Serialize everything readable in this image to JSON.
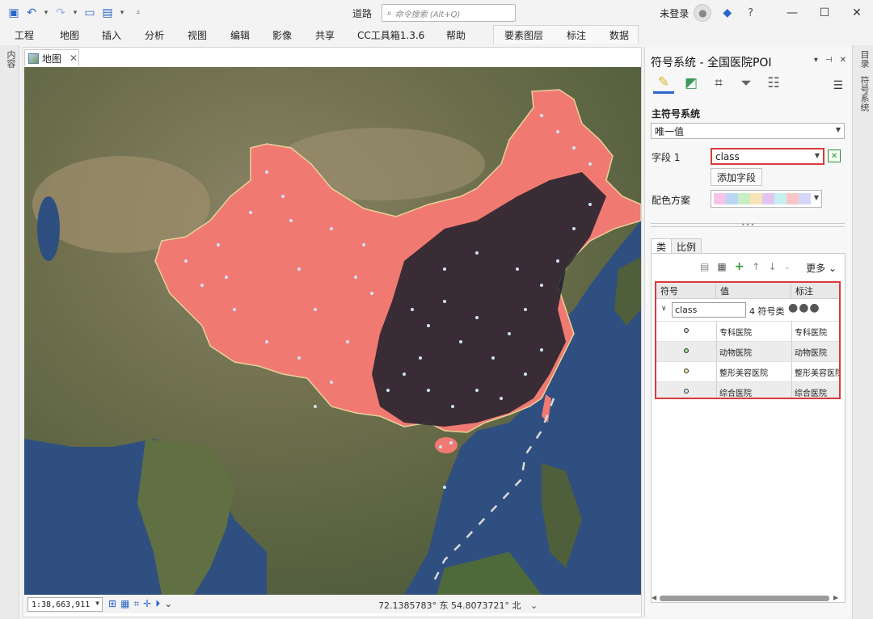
{
  "titlebar": {
    "doc_title": "道路",
    "search_placeholder": "命令搜索 (Alt+Q)",
    "user": "未登录"
  },
  "ribbon": {
    "tabs": [
      "工程",
      "地图",
      "插入",
      "分析",
      "视图",
      "编辑",
      "影像",
      "共享",
      "CC工具箱1.3.6",
      "帮助",
      "要素图层",
      "标注",
      "数据"
    ]
  },
  "left_strip": {
    "label": "内容"
  },
  "map": {
    "tab_label": "地图",
    "scale": "1:38,663,911",
    "coords": "72.1385783° 东 54.8073721° 北"
  },
  "panel": {
    "title": "符号系统 - 全国医院POI",
    "section_title": "主符号系统",
    "primary_method": "唯一值",
    "field_label": "字段 1",
    "field_value": "class",
    "add_field_button": "添加字段",
    "color_scheme_label": "配色方案",
    "color_ramp": [
      "#f7c3e6",
      "#b9d7f5",
      "#c7eec4",
      "#f9e3b8",
      "#e2c6f2",
      "#c6f0ef",
      "#f9c6c6",
      "#d6d6f9"
    ],
    "subtabs": [
      "类",
      "比例"
    ],
    "more_label": "更多",
    "table": {
      "headers": [
        "符号",
        "值",
        "标注"
      ],
      "group_field": "class",
      "group_count": "4 符号类",
      "group_dots": "●●●",
      "rows": [
        {
          "value": "专科医院",
          "label": "专科医院",
          "color": "#c9cfe0"
        },
        {
          "value": "动物医院",
          "label": "动物医院",
          "color": "#9ed69e"
        },
        {
          "value": "整形美容医院",
          "label": "整形美容医院",
          "color": "#efe0a8"
        },
        {
          "value": "综合医院",
          "label": "综合医院",
          "color": "#cfe4f5"
        }
      ]
    }
  },
  "right_strip": {
    "labels": [
      "目录",
      "符号系统"
    ]
  },
  "colors": {
    "accent": "#2b66c9",
    "highlight": "#d93a3a",
    "china_fill": "#f07a72"
  }
}
